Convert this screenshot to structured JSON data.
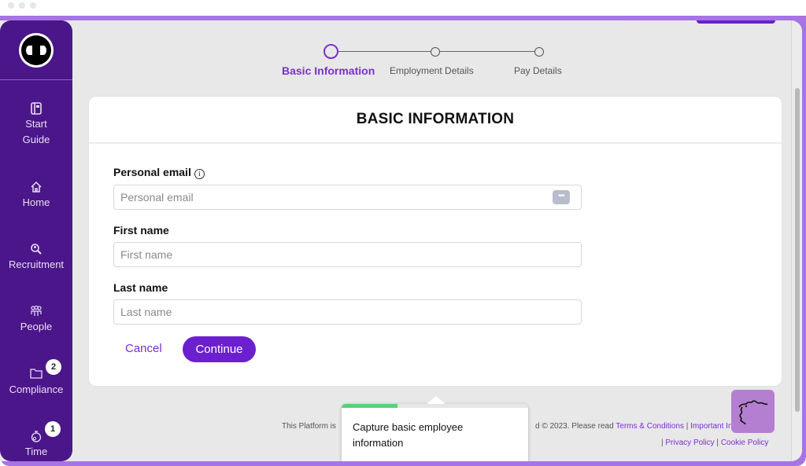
{
  "window": {
    "controls": [
      "close",
      "minimize",
      "maximize"
    ]
  },
  "sidebar": {
    "logo": "app-logo",
    "items": [
      {
        "label_line1": "Start",
        "label_line2": "Guide",
        "icon": "book-icon",
        "glyph": "◫"
      },
      {
        "label": "Home",
        "icon": "home-icon",
        "glyph": "⌂"
      },
      {
        "label": "Recruitment",
        "icon": "search-person-icon",
        "glyph": "⚲"
      },
      {
        "label": "People",
        "icon": "people-icon",
        "glyph": "☷"
      },
      {
        "label": "Compliance",
        "icon": "folder-icon",
        "glyph": "▭",
        "badge": "2"
      },
      {
        "label": "Time",
        "icon": "stopwatch-icon",
        "glyph": "⏱",
        "badge": "1"
      }
    ]
  },
  "stepper": {
    "steps": [
      {
        "label": "Basic Information",
        "active": true
      },
      {
        "label": "Employment Details",
        "active": false
      },
      {
        "label": "Pay Details",
        "active": false
      }
    ]
  },
  "form": {
    "title": "BASIC INFORMATION",
    "fields": [
      {
        "label": "Personal email",
        "placeholder": "Personal email",
        "value": "",
        "has_info": true,
        "info_glyph": "i",
        "password_manager_glyph": "•••"
      },
      {
        "label": "First name",
        "placeholder": "First name",
        "value": ""
      },
      {
        "label": "Last name",
        "placeholder": "Last name",
        "value": ""
      }
    ],
    "cancel_label": "Cancel",
    "continue_label": "Continue"
  },
  "tooltip": {
    "text": "Capture basic employee information",
    "progress_percent": 30
  },
  "footer": {
    "prefix": "This Platform is",
    "copyright": "d © 2023. Please read",
    "links": [
      "Terms & Conditions",
      "Important Information",
      "Privacy Policy",
      "Cookie Policy"
    ],
    "separator": "|"
  },
  "colors": {
    "brand_purple": "#4b1689",
    "accent_purple": "#6c1fcf",
    "frame_purple": "#a674e4",
    "progress_green": "#56d17a"
  }
}
